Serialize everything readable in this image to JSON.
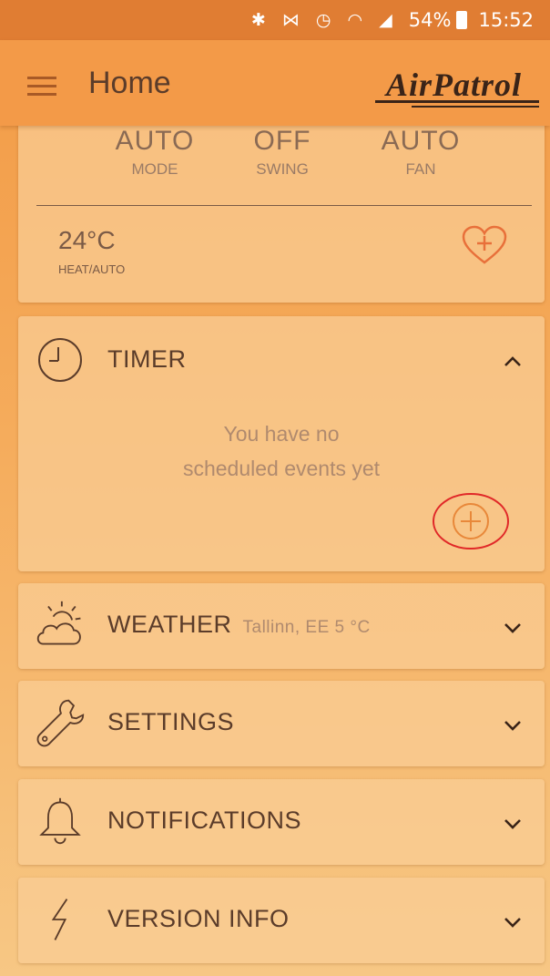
{
  "status": {
    "battery": "54%",
    "time": "15:52",
    "icons": "✱ ⋈ ◷ ◠ ◢"
  },
  "header": {
    "title": "Home",
    "logo": "AirPatrol"
  },
  "climate": {
    "mode_value": "AUTO",
    "mode_label": "MODE",
    "swing_value": "OFF",
    "swing_label": "SWING",
    "fan_value": "AUTO",
    "fan_label": "FAN",
    "temperature": "24°C",
    "temp_mode": "HEAT/AUTO"
  },
  "timer": {
    "title": "TIMER",
    "empty_line1": "You have no",
    "empty_line2": "scheduled events yet"
  },
  "weather": {
    "title": "WEATHER",
    "location": "Tallinn, EE 5 °C"
  },
  "settings": {
    "title": "SETTINGS"
  },
  "notifications": {
    "title": "NOTIFICATIONS"
  },
  "version": {
    "title": "VERSION INFO"
  },
  "colors": {
    "accent": "#f39a48",
    "statusbar": "#e07d33",
    "highlight": "#e02828"
  }
}
